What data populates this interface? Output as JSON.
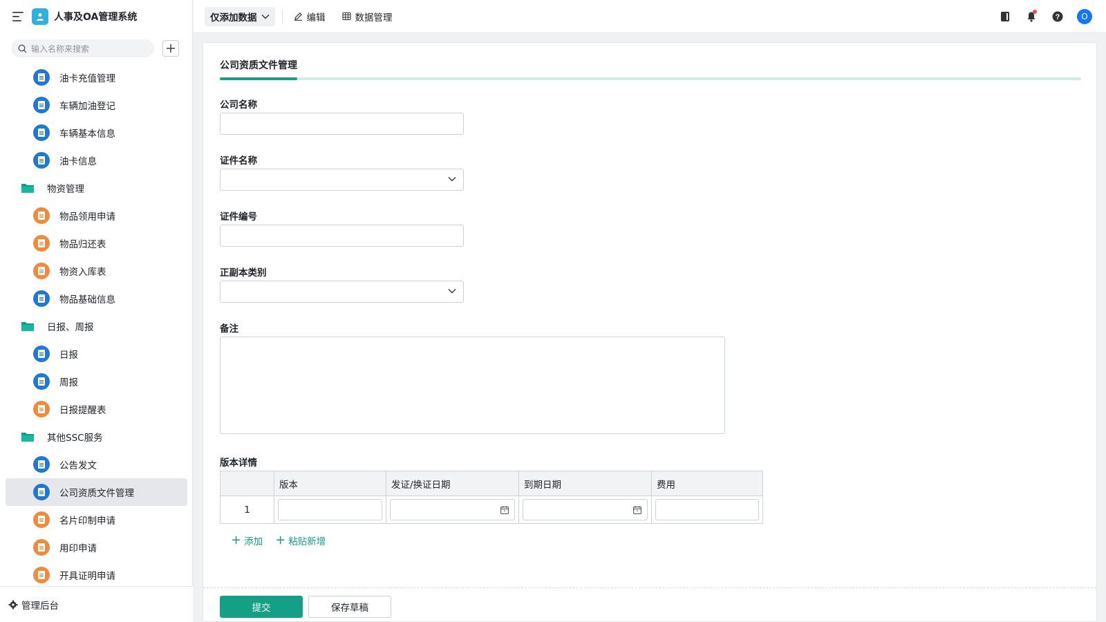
{
  "app": {
    "title": "人事及OA管理系统",
    "accent_color": "#14a085"
  },
  "sidebar": {
    "search_placeholder": "输入名称来搜索",
    "add_icon": "plus-icon",
    "items": [
      {
        "label": "油卡充值管理",
        "kind": "form",
        "color": "blue"
      },
      {
        "label": "车辆加油登记",
        "kind": "form",
        "color": "blue"
      },
      {
        "label": "车辆基本信息",
        "kind": "form",
        "color": "blue"
      },
      {
        "label": "油卡信息",
        "kind": "form",
        "color": "blue"
      },
      {
        "label": "物资管理",
        "kind": "folder"
      },
      {
        "label": "物品领用申请",
        "kind": "form",
        "color": "orange"
      },
      {
        "label": "物品归还表",
        "kind": "form",
        "color": "orange"
      },
      {
        "label": "物资入库表",
        "kind": "form",
        "color": "orange"
      },
      {
        "label": "物品基础信息",
        "kind": "form",
        "color": "blue"
      },
      {
        "label": "日报、周报",
        "kind": "folder"
      },
      {
        "label": "日报",
        "kind": "form",
        "color": "blue"
      },
      {
        "label": "周报",
        "kind": "form",
        "color": "blue"
      },
      {
        "label": "日报提醒表",
        "kind": "form",
        "color": "orange"
      },
      {
        "label": "其他SSC服务",
        "kind": "folder"
      },
      {
        "label": "公告发文",
        "kind": "form",
        "color": "blue"
      },
      {
        "label": "公司资质文件管理",
        "kind": "form",
        "color": "blue",
        "active": true
      },
      {
        "label": "名片印制申请",
        "kind": "form",
        "color": "orange"
      },
      {
        "label": "用印申请",
        "kind": "form",
        "color": "orange"
      },
      {
        "label": "开具证明申请",
        "kind": "form",
        "color": "orange"
      }
    ],
    "footer_label": "管理后台"
  },
  "topbar": {
    "mode_label": "仅添加数据",
    "edit_label": "编辑",
    "data_manage_label": "数据管理",
    "avatar_initial": "O"
  },
  "form": {
    "title": "公司资质文件管理",
    "progress": 0.09,
    "fields": {
      "company_name": {
        "label": "公司名称",
        "value": ""
      },
      "cert_name": {
        "label": "证件名称",
        "value": ""
      },
      "cert_number": {
        "label": "证件编号",
        "value": ""
      },
      "copy_type": {
        "label": "正副本类别",
        "value": ""
      },
      "remark": {
        "label": "备注",
        "value": ""
      }
    },
    "subtable": {
      "label": "版本详情",
      "columns": [
        "版本",
        "发证/换证日期",
        "到期日期",
        "费用"
      ],
      "rows": [
        {
          "index": "1",
          "version": "",
          "issue_date": "",
          "expire_date": "",
          "fee": ""
        }
      ],
      "add_label": "添加",
      "paste_label": "粘贴新增"
    },
    "submit_label": "提交",
    "draft_label": "保存草稿"
  }
}
